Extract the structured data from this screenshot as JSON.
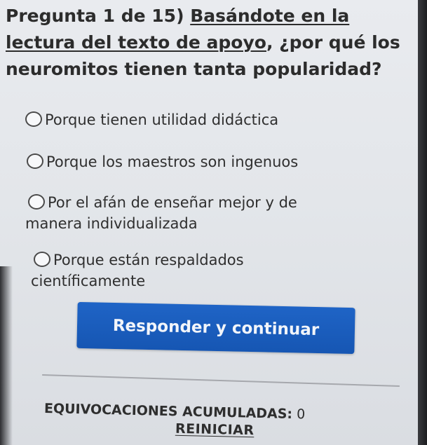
{
  "question": {
    "prefix": "Pregunta 1 de 15) ",
    "underlined_1": "Basándote en la lectura del texto de apoyo",
    "suffix": ", ¿por qué los neuromitos tienen tanta popularidad?"
  },
  "options": [
    {
      "label": "Porque tienen utilidad didáctica",
      "selected": false
    },
    {
      "label": "Porque los maestros son ingenuos",
      "selected": false
    },
    {
      "label_line1": "Por el afán de enseñar mejor y de",
      "label_line2": "manera individualizada",
      "selected": false
    },
    {
      "label_line1": "Porque están respaldados",
      "label_line2": "científicamente",
      "selected": false
    }
  ],
  "submit_button": {
    "label": "Responder y continuar",
    "color": "#1a5cbd"
  },
  "footer": {
    "mistakes_label": "EQUIVOCACIONES ACUMULADAS:",
    "mistakes_count": "0",
    "restart_label": "REINICIAR"
  }
}
